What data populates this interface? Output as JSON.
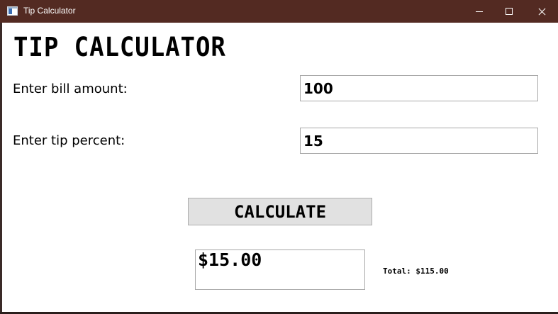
{
  "window": {
    "title": "Tip Calculator",
    "titlebar_color": "#532a22",
    "controls": {
      "minimize_icon": "minimize-icon",
      "maximize_icon": "maximize-icon",
      "close_icon": "close-icon"
    }
  },
  "app": {
    "heading": "TIP CALCULATOR",
    "bill_label": "Enter bill amount:",
    "bill_value": "100",
    "tip_label": "Enter tip percent:",
    "tip_value": "15",
    "calculate_label": "CALCULATE",
    "tip_result": "$15.00",
    "total_text": "Total: $115.00"
  }
}
